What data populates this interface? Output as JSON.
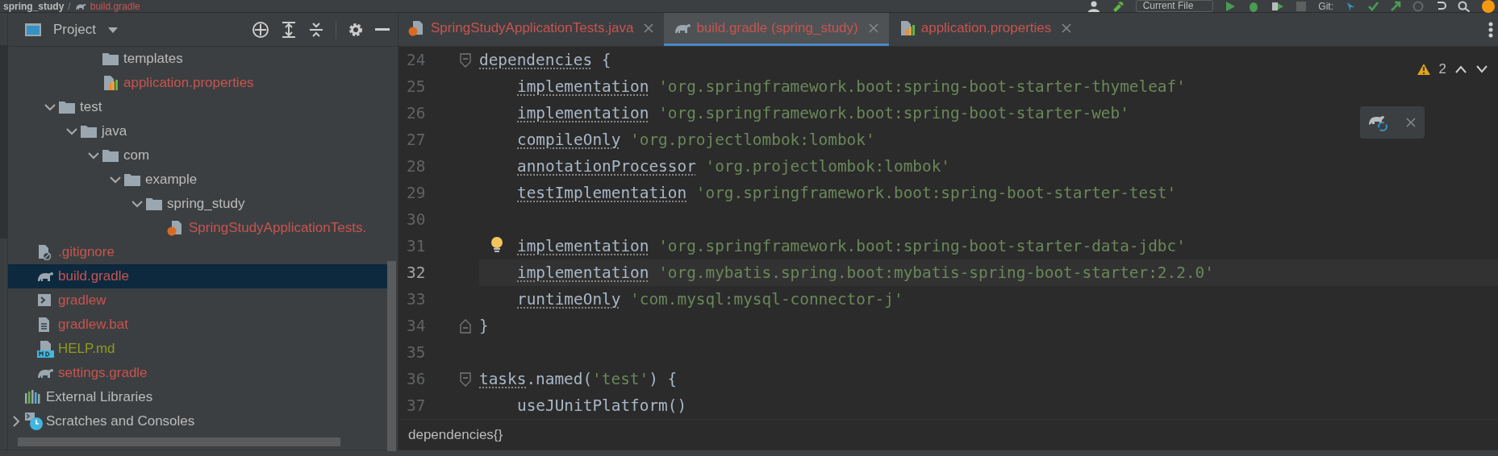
{
  "topbar": {
    "breadcrumbs": [
      {
        "label": "spring_study",
        "color": "#bbbbbb"
      },
      {
        "label": "build.gradle",
        "kind": "gradle",
        "color": "#c75450"
      }
    ],
    "separator": "/",
    "run_config": "Current File",
    "git_label": "Git:"
  },
  "project_panel": {
    "title": "Project",
    "tree": [
      {
        "children": [
          {
            "children": [
              {
                "children": [
                  {
                    "children": [
                      {
                        "label": "templates",
                        "kind": "folder",
                        "color": "#bbbbbb",
                        "selected": false
                      },
                      {
                        "label": "application.properties",
                        "kind": "properties",
                        "color": "#c75450",
                        "selected": false
                      }
                    ]
                  }
                ]
              },
              {
                "label": "test",
                "kind": "folder",
                "color": "#bbbbbb",
                "selected": false,
                "expanded": true,
                "children": [
                  {
                    "label": "java",
                    "kind": "folder",
                    "color": "#bbbbbb",
                    "selected": false,
                    "expanded": true,
                    "children": [
                      {
                        "label": "com",
                        "kind": "folder",
                        "color": "#bbbbbb",
                        "selected": false,
                        "expanded": true,
                        "children": [
                          {
                            "label": "example",
                            "kind": "folder",
                            "color": "#bbbbbb",
                            "selected": false,
                            "expanded": true,
                            "children": [
                              {
                                "label": "spring_study",
                                "kind": "folder",
                                "color": "#bbbbbb",
                                "selected": false,
                                "expanded": true,
                                "children": [
                                  {
                                    "label": "SpringStudyApplicationTests.",
                                    "kind": "java",
                                    "color": "#c75450",
                                    "selected": false
                                  }
                                ]
                              }
                            ]
                          }
                        ]
                      }
                    ]
                  }
                ]
              }
            ]
          },
          {
            "label": ".gitignore",
            "kind": "gitignore",
            "color": "#c75450",
            "selected": false
          },
          {
            "label": "build.gradle",
            "kind": "gradle",
            "color": "#c75450",
            "selected": true
          },
          {
            "label": "gradlew",
            "kind": "shell",
            "color": "#c75450",
            "selected": false
          },
          {
            "label": "gradlew.bat",
            "kind": "text",
            "color": "#c75450",
            "selected": false
          },
          {
            "label": "HELP.md",
            "kind": "markdown",
            "color": "#8f9a1f",
            "selected": false
          },
          {
            "label": "settings.gradle",
            "kind": "gradle",
            "color": "#c75450",
            "selected": false
          }
        ]
      },
      {
        "label": "External Libraries",
        "kind": "libraries",
        "color": "#bbbbbb",
        "selected": false
      },
      {
        "label": "Scratches and Consoles",
        "kind": "scratches",
        "color": "#bbbbbb",
        "selected": false,
        "expanded": false
      }
    ]
  },
  "editor": {
    "tabs": [
      {
        "label": "SpringStudyApplicationTests.java",
        "kind": "java",
        "color": "#c75450",
        "selected": false
      },
      {
        "label": "build.gradle (spring_study)",
        "kind": "gradle",
        "color": "#c75450",
        "selected": true
      },
      {
        "label": "application.properties",
        "kind": "properties",
        "color": "#c75450",
        "selected": false
      }
    ],
    "warning_count": "2",
    "lines": [
      {
        "number": "24",
        "current": false,
        "kind": "fold-start",
        "tokens": [
          {
            "text": "dependencies",
            "kind": "call"
          },
          {
            "text": " {",
            "kind": "plain"
          }
        ],
        "children": [
          {
            "number": "25",
            "current": false,
            "kind": "plain",
            "tokens": [
              {
                "text": "implementation",
                "kind": "call"
              },
              {
                "text": "'org.springframework.boot:spring-boot-starter-thymeleaf'",
                "kind": "string"
              }
            ]
          },
          {
            "number": "26",
            "current": false,
            "kind": "plain",
            "tokens": [
              {
                "text": "implementation",
                "kind": "call"
              },
              {
                "text": "'org.springframework.boot:spring-boot-starter-web'",
                "kind": "string"
              }
            ]
          },
          {
            "number": "27",
            "current": false,
            "kind": "plain",
            "tokens": [
              {
                "text": "compileOnly",
                "kind": "call"
              },
              {
                "text": "'org.projectlombok:lombok'",
                "kind": "string"
              }
            ]
          },
          {
            "number": "28",
            "current": false,
            "kind": "plain",
            "tokens": [
              {
                "text": "annotationProcessor",
                "kind": "call"
              },
              {
                "text": "'org.projectlombok:lombok'",
                "kind": "string"
              }
            ]
          },
          {
            "number": "29",
            "current": false,
            "kind": "plain",
            "tokens": [
              {
                "text": "testImplementation",
                "kind": "call"
              },
              {
                "text": "'org.springframework.boot:spring-boot-starter-test'",
                "kind": "string"
              }
            ]
          },
          {
            "number": "30",
            "current": false,
            "kind": "plain"
          },
          {
            "number": "31",
            "current": false,
            "kind": "bulb",
            "tokens": [
              {
                "text": "implementation",
                "kind": "call"
              },
              {
                "text": "'org.springframework.boot:spring-boot-starter-data-jdbc'",
                "kind": "string"
              }
            ]
          },
          {
            "number": "32",
            "current": true,
            "kind": "plain",
            "tokens": [
              {
                "text": "implementation",
                "kind": "call"
              },
              {
                "text": "'org.mybatis.spring.boot:mybatis-spring-boot-starter:2.2.0'",
                "kind": "string"
              }
            ]
          },
          {
            "number": "33",
            "current": false,
            "kind": "plain",
            "tokens": [
              {
                "text": "runtimeOnly",
                "kind": "call"
              },
              {
                "text": "'com.mysql:mysql-connector-j'",
                "kind": "string"
              }
            ]
          }
        ]
      },
      {
        "number": "34",
        "current": false,
        "kind": "fold-end",
        "tokens": [
          {
            "text": "}",
            "kind": "plain"
          }
        ]
      },
      {
        "number": "35",
        "current": false,
        "kind": "plain"
      },
      {
        "number": "36",
        "current": false,
        "kind": "fold-start",
        "tokens": [
          {
            "text": "tasks",
            "kind": "call"
          },
          {
            "text": ".named(",
            "kind": "plain"
          },
          {
            "text": "'test'",
            "kind": "string"
          },
          {
            "text": ") {",
            "kind": "plain"
          }
        ],
        "children": [
          {
            "number": "37",
            "current": false,
            "kind": "plain",
            "tokens": [
              {
                "text": "useJUnitPlatform()",
                "kind": "plain"
              }
            ]
          }
        ]
      }
    ],
    "breadcrumb": "dependencies{}"
  }
}
